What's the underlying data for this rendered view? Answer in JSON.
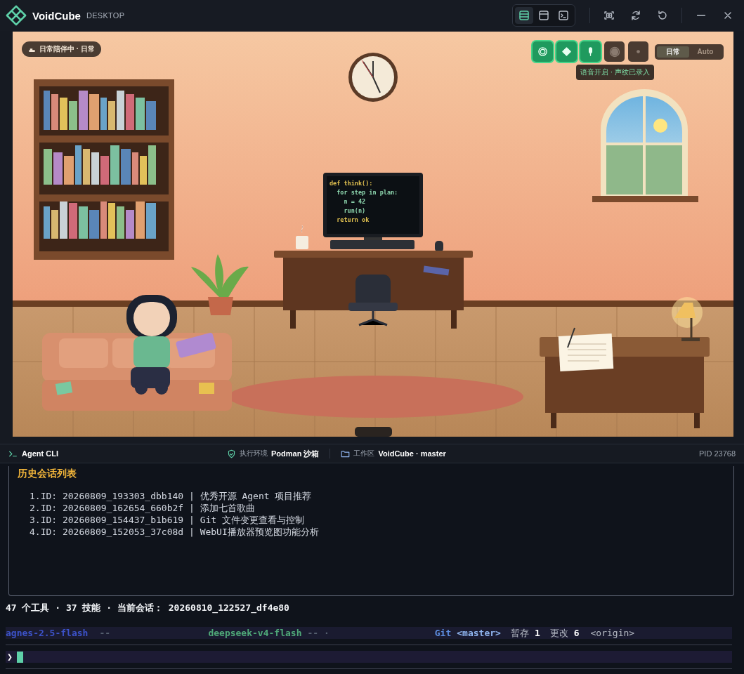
{
  "window": {
    "logo_text": "VoidCube",
    "subtitle": "DESKTOP",
    "layout_buttons": [
      {
        "kind": "rows",
        "selected": true
      },
      {
        "kind": "panel",
        "selected": false
      },
      {
        "kind": "terminal",
        "selected": false
      }
    ]
  },
  "scene": {
    "status_badge": "日常陪伴中 · 日常",
    "voice_buttons": [
      {
        "kind": "rings",
        "on": true
      },
      {
        "kind": "diamond",
        "on": true
      },
      {
        "kind": "mic",
        "on": true
      },
      {
        "kind": "record",
        "on": false
      },
      {
        "kind": "dot",
        "on": false
      }
    ],
    "mode_toggle": [
      {
        "label": "日常",
        "selected": true
      },
      {
        "label": "Auto",
        "selected": false
      }
    ],
    "tooltip": "语音开启 · 声纹已录入",
    "monitor_code": [
      "def think():",
      "  for step in plan:",
      "    n = 42",
      "    run(n)",
      "  return ok"
    ]
  },
  "cli_header": {
    "title": "Agent CLI",
    "env_label": "执行环境",
    "env_value": "Podman 沙箱",
    "workspace_label": "工作区",
    "workspace_value": "VoidCube · master",
    "pid": "PID 23768"
  },
  "history": {
    "title": "历史会话列表",
    "sessions": [
      {
        "text": "1.ID: 20260809_193303_dbb140 | 优秀开源 Agent 项目推荐"
      },
      {
        "text": "2.ID: 20260809_162654_660b2f | 添加七首歌曲"
      },
      {
        "text": "3.ID: 20260809_154437_b1b619 | Git 文件变更查看与控制"
      },
      {
        "text": "4.ID: 20260809_152053_37c08d | WebUI播放器预览图功能分析"
      }
    ]
  },
  "status_line": "47 个工具 · 37 技能 · 当前会话： 20260810_122527_df4e80",
  "model_bar": {
    "left_model": "agnes-2.5-flash",
    "left_sep": "--",
    "center_model": "deepseek-v4-flash",
    "center_sep": "-- ·",
    "git_label": "Git",
    "branch": "<master>",
    "staged_label": "暂存",
    "staged": "1",
    "changed_label": "更改",
    "changed": "6",
    "remote": "<origin>"
  },
  "prompt": {
    "symbol": "❯"
  }
}
